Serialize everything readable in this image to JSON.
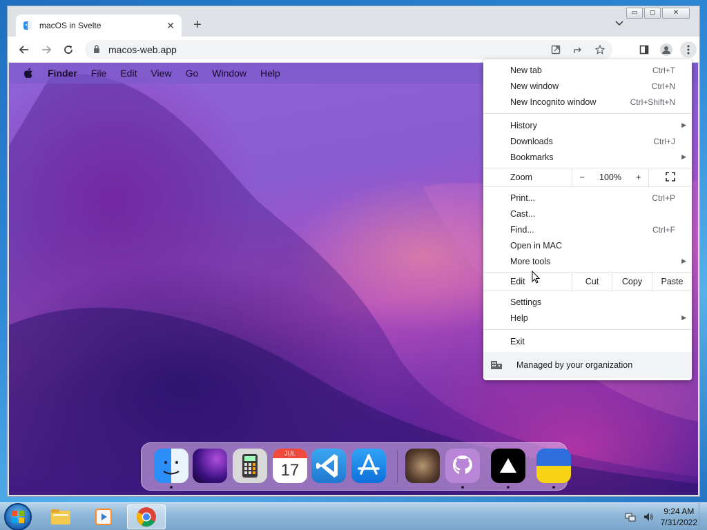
{
  "browser": {
    "tab_title": "macOS in Svelte",
    "new_tab_glyph": "+",
    "tab_close_glyph": "✕",
    "url": "macos-web.app",
    "window_controls": [
      "▭",
      "◻",
      "✕"
    ]
  },
  "mac": {
    "menubar": [
      "Finder",
      "File",
      "Edit",
      "View",
      "Go",
      "Window",
      "Help"
    ],
    "calendar_month": "JUL",
    "calendar_day": "17",
    "dock_apps": [
      "finder-icon",
      "wallpapers-icon",
      "calculator-icon",
      "calendar-icon",
      "vscode-icon",
      "app-store-icon",
      "cat-photo-icon",
      "github-icon",
      "vercel-icon",
      "ukraine-flag-icon"
    ]
  },
  "chrome_menu": {
    "new_tab": {
      "label": "New tab",
      "shortcut": "Ctrl+T"
    },
    "new_window": {
      "label": "New window",
      "shortcut": "Ctrl+N"
    },
    "incognito": {
      "label": "New Incognito window",
      "shortcut": "Ctrl+Shift+N"
    },
    "history": {
      "label": "History"
    },
    "downloads": {
      "label": "Downloads",
      "shortcut": "Ctrl+J"
    },
    "bookmarks": {
      "label": "Bookmarks"
    },
    "zoom": {
      "label": "Zoom",
      "minus": "−",
      "value": "100%",
      "plus": "+"
    },
    "print": {
      "label": "Print...",
      "shortcut": "Ctrl+P"
    },
    "cast": {
      "label": "Cast..."
    },
    "find": {
      "label": "Find...",
      "shortcut": "Ctrl+F"
    },
    "open_in_mac": {
      "label": "Open in MAC"
    },
    "more_tools": {
      "label": "More tools"
    },
    "edit": {
      "label": "Edit",
      "cut": "Cut",
      "copy": "Copy",
      "paste": "Paste"
    },
    "settings": {
      "label": "Settings"
    },
    "help": {
      "label": "Help"
    },
    "exit": {
      "label": "Exit"
    },
    "managed": {
      "label": "Managed by your organization"
    }
  },
  "taskbar": {
    "time": "9:24 AM",
    "date": "7/31/2022"
  }
}
